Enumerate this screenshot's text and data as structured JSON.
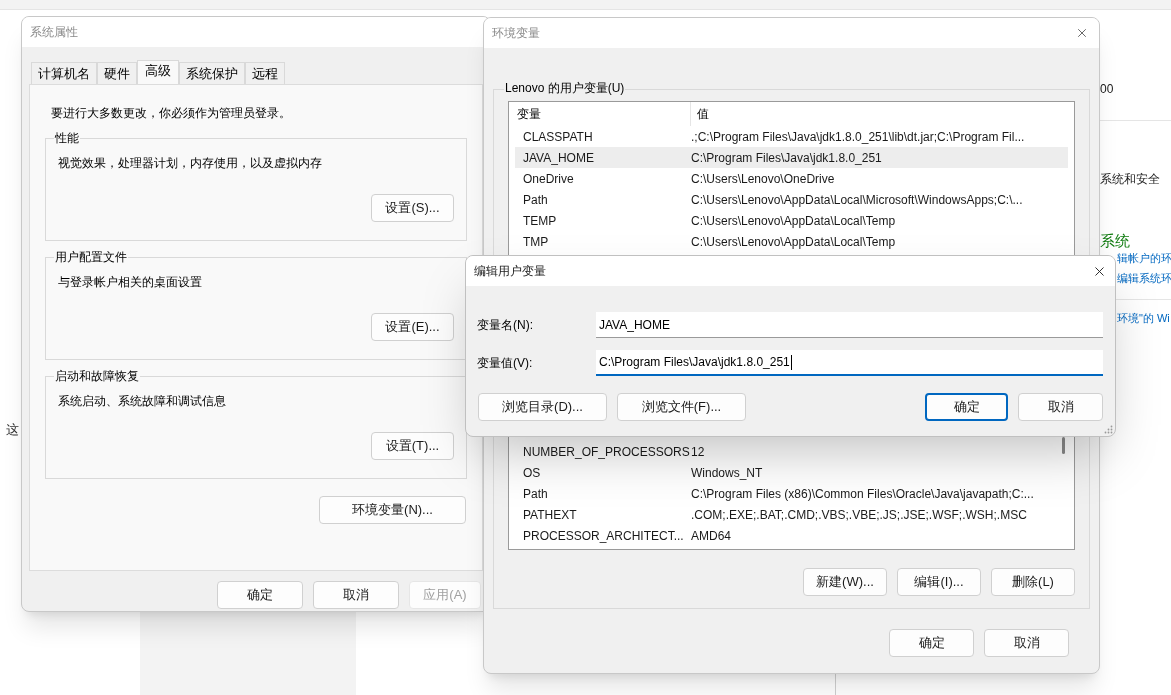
{
  "background": {
    "left_text": "这",
    "right_texts": [
      {
        "text": "00",
        "kind": "plain"
      },
      {
        "text": "系统和安全",
        "kind": "plain"
      },
      {
        "text": "系统",
        "kind": "heading"
      },
      {
        "text": "辑帐户的环",
        "kind": "link"
      },
      {
        "text": "编辑系统环",
        "kind": "link"
      },
      {
        "text": "环境\"的 Wi",
        "kind": "link"
      }
    ]
  },
  "system_properties": {
    "title": "系统属性",
    "tabs": [
      {
        "label": "计算机名",
        "selected": false
      },
      {
        "label": "硬件",
        "selected": false
      },
      {
        "label": "高级",
        "selected": true
      },
      {
        "label": "系统保护",
        "selected": false
      },
      {
        "label": "远程",
        "selected": false
      }
    ],
    "notice": "要进行大多数更改，你必须作为管理员登录。",
    "groups": [
      {
        "title": "性能",
        "description": "视觉效果，处理器计划，内存使用，以及虚拟内存",
        "button": "设置(S)..."
      },
      {
        "title": "用户配置文件",
        "description": "与登录帐户相关的桌面设置",
        "button": "设置(E)..."
      },
      {
        "title": "启动和故障恢复",
        "description": "系统启动、系统故障和调试信息",
        "button": "设置(T)..."
      }
    ],
    "env_button": "环境变量(N)...",
    "buttons": [
      {
        "label": "确定",
        "disabled": false
      },
      {
        "label": "取消",
        "disabled": false
      },
      {
        "label": "应用(A)",
        "disabled": true
      }
    ]
  },
  "environment_variables": {
    "title": "环境变量",
    "user_group": {
      "title": "Lenovo 的用户变量(U)",
      "columns": [
        "变量",
        "值"
      ],
      "rows": [
        {
          "name": "CLASSPATH",
          "value": ".;C:\\Program Files\\Java\\jdk1.8.0_251\\lib\\dt.jar;C:\\Program Fil...",
          "selected": false
        },
        {
          "name": "JAVA_HOME",
          "value": "C:\\Program Files\\Java\\jdk1.8.0_251",
          "selected": true
        },
        {
          "name": "OneDrive",
          "value": "C:\\Users\\Lenovo\\OneDrive",
          "selected": false
        },
        {
          "name": "Path",
          "value": "C:\\Users\\Lenovo\\AppData\\Local\\Microsoft\\WindowsApps;C:\\...",
          "selected": false
        },
        {
          "name": "TEMP",
          "value": "C:\\Users\\Lenovo\\AppData\\Local\\Temp",
          "selected": false
        },
        {
          "name": "TMP",
          "value": "C:\\Users\\Lenovo\\AppData\\Local\\Temp",
          "selected": false
        }
      ]
    },
    "system_rows": [
      {
        "name": "NUMBER_OF_PROCESSORS",
        "value": "12"
      },
      {
        "name": "OS",
        "value": "Windows_NT"
      },
      {
        "name": "Path",
        "value": "C:\\Program Files (x86)\\Common Files\\Oracle\\Java\\javapath;C:..."
      },
      {
        "name": "PATHEXT",
        "value": ".COM;.EXE;.BAT;.CMD;.VBS;.VBE;.JS;.JSE;.WSF;.WSH;.MSC"
      },
      {
        "name": "PROCESSOR_ARCHITECT...",
        "value": "AMD64"
      }
    ],
    "system_buttons": [
      "新建(W)...",
      "编辑(I)...",
      "删除(L)"
    ],
    "buttons": [
      "确定",
      "取消"
    ]
  },
  "edit_dialog": {
    "title": "编辑用户变量",
    "fields": [
      {
        "label": "变量名(N):",
        "value": "JAVA_HOME",
        "focused": false
      },
      {
        "label": "变量值(V):",
        "value": "C:\\Program Files\\Java\\jdk1.8.0_251",
        "focused": true
      }
    ],
    "left_buttons": [
      "浏览目录(D)...",
      "浏览文件(F)..."
    ],
    "buttons": [
      {
        "label": "确定",
        "default": true
      },
      {
        "label": "取消",
        "default": false
      }
    ]
  }
}
